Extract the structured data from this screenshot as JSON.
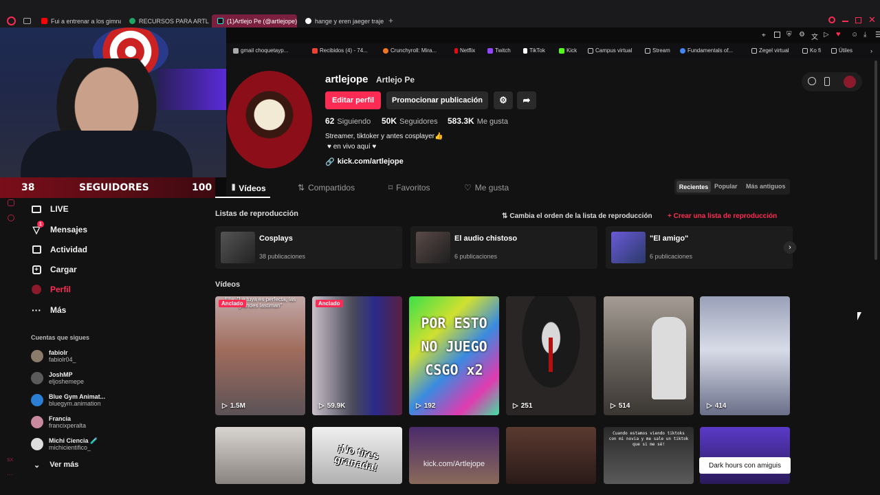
{
  "browser": {
    "tabs": [
      {
        "label": "Fui a entrenar a los gimna",
        "color": "#ff0000"
      },
      {
        "label": "RECURSOS PARA ARTLE",
        "color": "#1fa463"
      },
      {
        "label": "(1)Artlejo Pe (@artlejope)",
        "color": "#25f4ee"
      },
      {
        "label": "hange y eren jaeger traje",
        "color": "#ffffff"
      }
    ],
    "new_tab": "+",
    "bookmarks": [
      "gmail choquetayp...",
      "Recibidos (4) - 74...",
      "Crunchyroll: Mira...",
      "Netflix",
      "Twitch",
      "TikTok",
      "Kick",
      "Campus virtual",
      "Stream",
      "Fundamentals of...",
      "Zegel virtual",
      "Ko fi",
      "Útiles"
    ]
  },
  "stream_overlay": {
    "followers_current": "38",
    "followers_label": "SEGUIDORES",
    "followers_goal": "100"
  },
  "sidebar": {
    "nav": [
      {
        "label": "LIVE",
        "icon": "live-icon"
      },
      {
        "label": "Mensajes",
        "icon": "messages-icon",
        "badge": "1"
      },
      {
        "label": "Actividad",
        "icon": "activity-icon"
      },
      {
        "label": "Cargar",
        "icon": "upload-icon"
      },
      {
        "label": "Perfil",
        "icon": "profile-icon"
      },
      {
        "label": "Más",
        "icon": "more-icon"
      }
    ],
    "following_title": "Cuentas que sigues",
    "following": [
      {
        "name": "fabiolr",
        "handle": "fabiolr04_"
      },
      {
        "name": "JoshMP",
        "handle": "eljoshemepe"
      },
      {
        "name": "Blue Gym Animat...",
        "handle": "bluegym.animation"
      },
      {
        "name": "Francia",
        "handle": "francixperalta"
      },
      {
        "name": "Michi Ciencia 🧪",
        "handle": "michicientifico_"
      }
    ],
    "see_more": "Ver más"
  },
  "profile": {
    "username": "artlejope",
    "display_name": "Artlejo Pe",
    "edit_button": "Editar perfil",
    "promote_button": "Promocionar publicación",
    "stats": [
      {
        "value": "62",
        "label": "Siguiendo"
      },
      {
        "value": "50K",
        "label": "Seguidores"
      },
      {
        "value": "583.3K",
        "label": "Me gusta"
      }
    ],
    "bio_line1": "Streamer, tiktoker y antes cosplayer👍",
    "bio_line2": "♥ en vivo aquí ♥",
    "link": "kick.com/artlejope",
    "tabs": [
      "Vídeos",
      "Compartidos",
      "Favoritos",
      "Me gusta"
    ],
    "sort": [
      "Recientes",
      "Popular",
      "Más antiguos"
    ]
  },
  "playlists": {
    "title": "Listas de reproducción",
    "reorder": "Cambia el orden de la lista de reproducción",
    "create": "+ Crear una lista de reproducción",
    "items": [
      {
        "title": "Cosplays",
        "count": "38 publicaciones"
      },
      {
        "title": "El audio chistoso",
        "count": "6 publicaciones"
      },
      {
        "title": "\"El amigo\"",
        "count": "6 publicaciones"
      }
    ]
  },
  "videos": {
    "title": "Vídeos",
    "pinned_label": "Anclado",
    "row1": [
      {
        "views": "1.5M",
        "pinned": true,
        "caption": "Ella: \"La tuya es perfecta, las grandes lastiman\""
      },
      {
        "views": "59.9K",
        "pinned": true,
        "caption": ""
      },
      {
        "views": "192",
        "pinned": false,
        "caption": "POR ESTO NO JUEGO CSGO x2"
      },
      {
        "views": "251",
        "pinned": false,
        "caption": ""
      },
      {
        "views": "514",
        "pinned": false,
        "caption": ""
      },
      {
        "views": "414",
        "pinned": false,
        "caption": ""
      }
    ],
    "row2_captions": [
      "",
      "¡No tires granada!",
      "kick.com/Artlejope",
      "",
      "Cuando estamos viendo tiktoks con mi novia y me sale un tiktok que si me sé!",
      ""
    ],
    "tooltip": "Dark hours con amiguis"
  },
  "colors": {
    "accent": "#fe2c55",
    "overlay_red": "#7a0e1a"
  }
}
